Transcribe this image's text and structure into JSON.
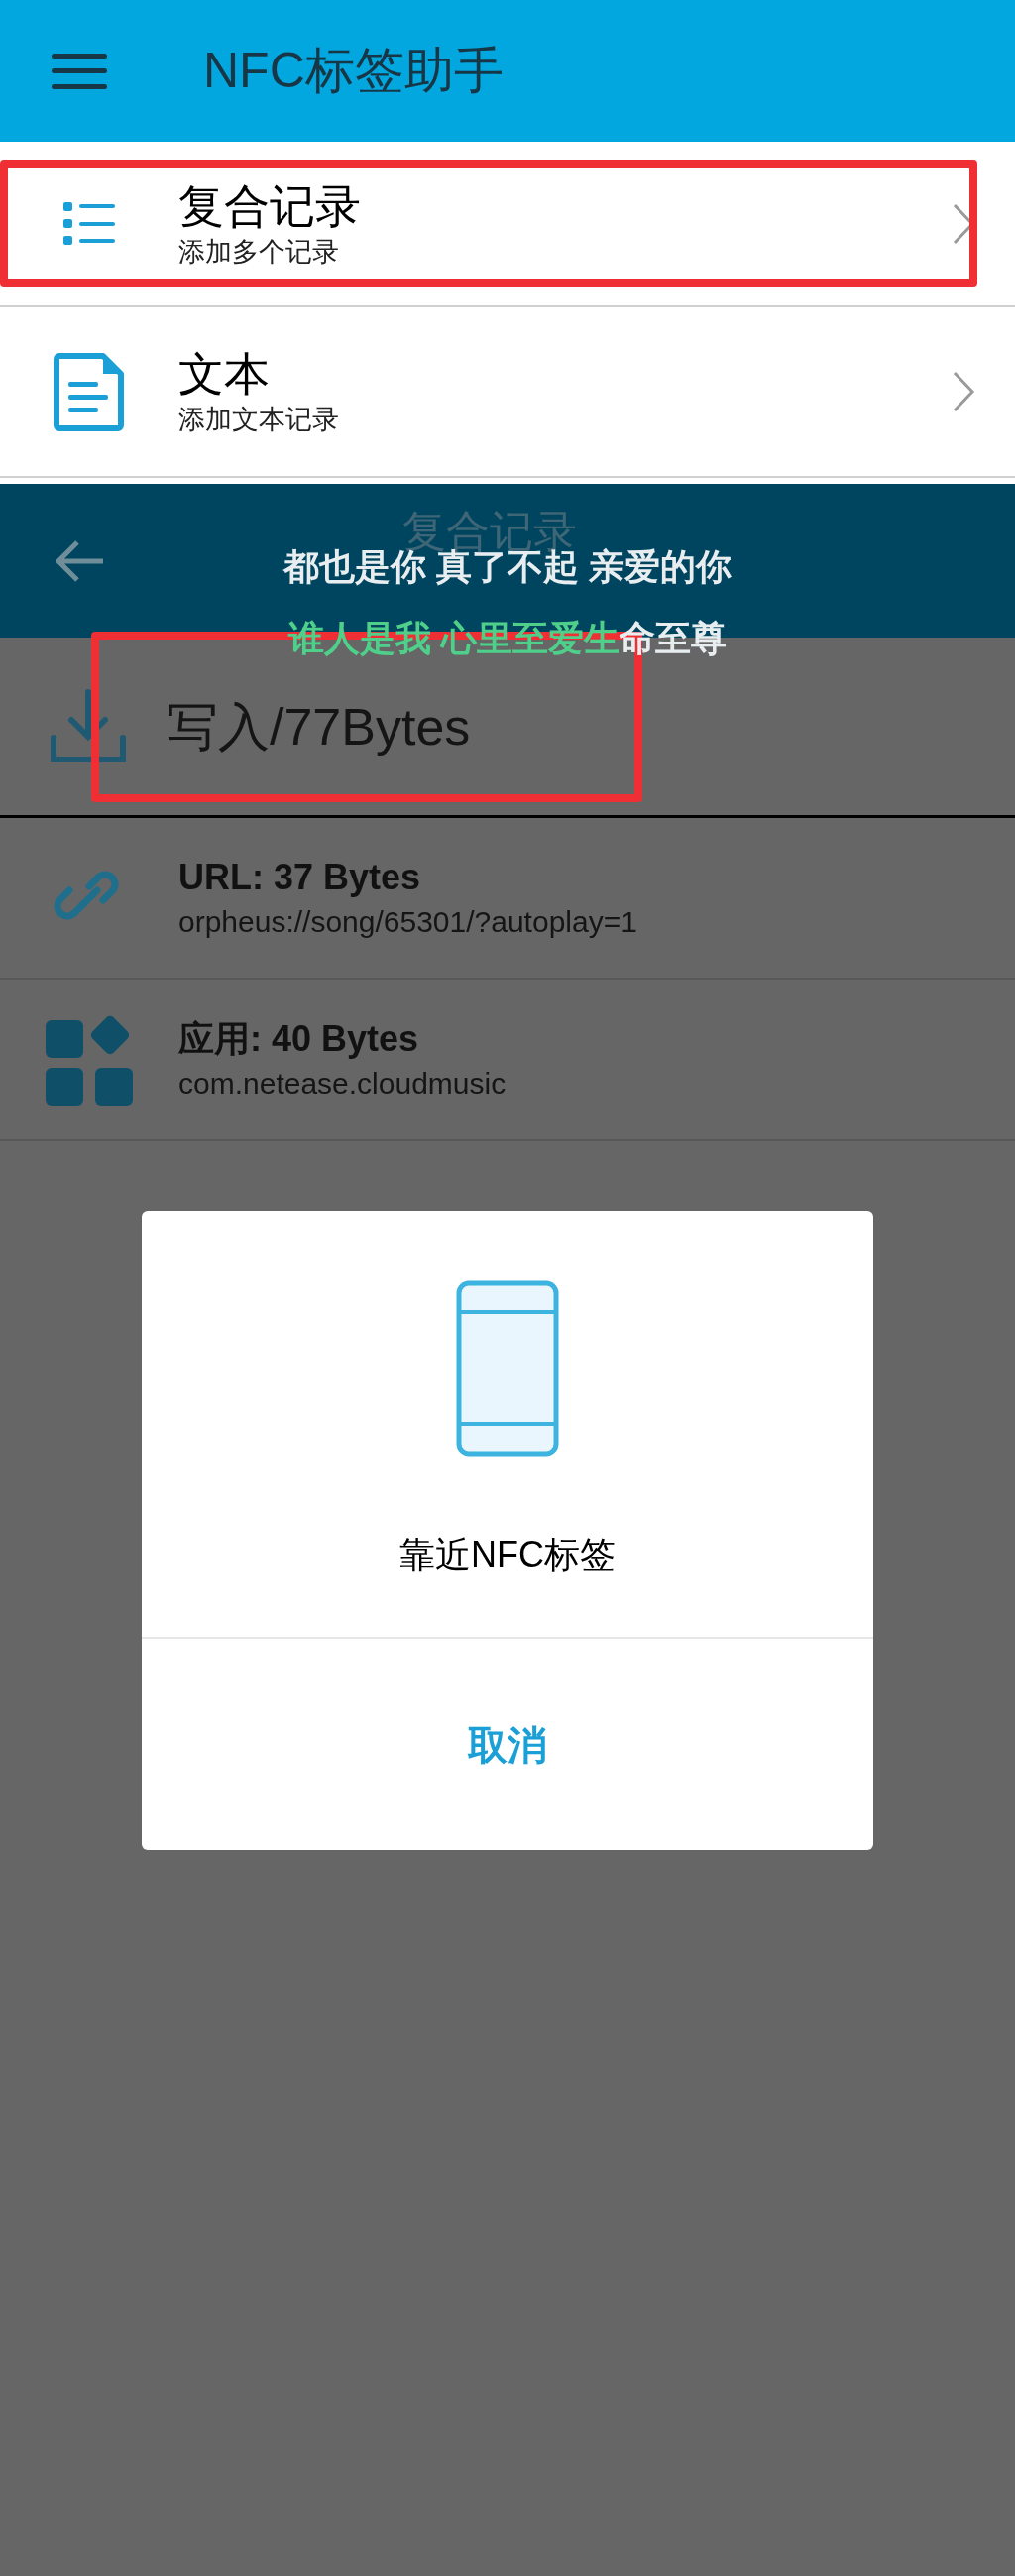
{
  "app_bar": {
    "title": "NFC标签助手"
  },
  "record_types": [
    {
      "kind": "list",
      "title": "复合记录",
      "subtitle": "添加多个记录",
      "highlighted": true
    },
    {
      "kind": "text",
      "title": "文本",
      "subtitle": "添加文本记录",
      "highlighted": false
    }
  ],
  "editor": {
    "title": "复合记录",
    "write_button": {
      "label": "写入/77Bytes",
      "highlighted": true
    },
    "records": [
      {
        "kind": "link",
        "title": "URL: 37 Bytes",
        "value": "orpheus://song/65301/?autoplay=1"
      },
      {
        "kind": "app",
        "title": "应用: 40 Bytes",
        "value": "com.netease.cloudmusic"
      }
    ]
  },
  "lyrics": [
    {
      "unsung": "都也是你 真了不起 亲爱的你"
    },
    {
      "sung": "谁人是我 心里至爱生",
      "unsung": "命至尊"
    }
  ],
  "dialog": {
    "message": "靠近NFC标签",
    "cancel": "取消"
  }
}
